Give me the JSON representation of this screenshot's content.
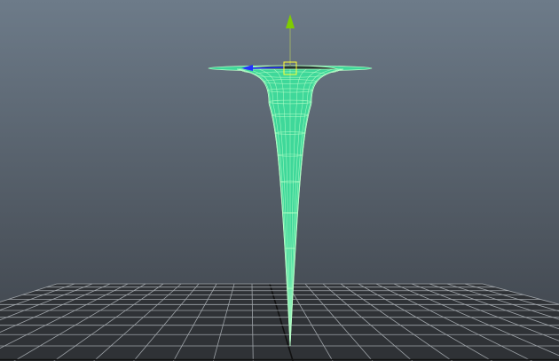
{
  "viewport": {
    "type": "3d-perspective-viewport",
    "background_top": "#6d7b89",
    "background_bottom": "#3d4249",
    "grid_color": "#9ea3a8",
    "grid_axis_color": "#111111"
  },
  "object": {
    "shape": "funnel",
    "fill_color": "#3fd89a",
    "wire_color": "#b8ffc8",
    "selected": true
  },
  "manipulator": {
    "type": "move-tool",
    "y_axis_color": "#7fcc00",
    "x_axis_color": "#2233ff",
    "center_color": "#ffff33"
  }
}
